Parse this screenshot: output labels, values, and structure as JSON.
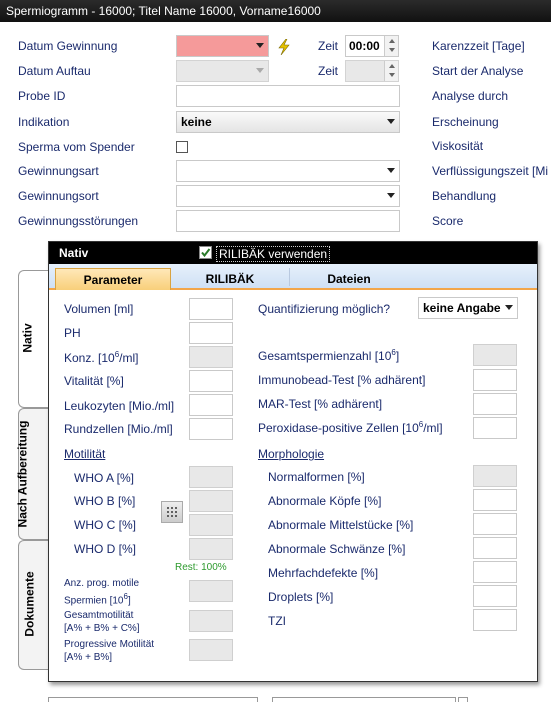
{
  "window": {
    "title": "Spermiogramm - 16000; Titel Name 16000, Vorname16000"
  },
  "form": {
    "datum_gewinnung": "Datum Gewinnung",
    "datum_auftau": "Datum Auftau",
    "probe_id": "Probe ID",
    "indikation": "Indikation",
    "indikation_value": "keine",
    "sperma_vom_spender": "Sperma vom Spender",
    "gewinnungsart": "Gewinnungsart",
    "gewinnungsort": "Gewinnungsort",
    "gewinnungsstoerungen": "Gewinnungsstörungen",
    "zeit1": "Zeit",
    "zeit1_value": "00:00",
    "zeit2": "Zeit"
  },
  "right_labels": {
    "karenzzeit": "Karenzzeit [Tage]",
    "start_analyse": "Start der Analyse",
    "analyse_durch": "Analyse durch",
    "erscheinung": "Erscheinung",
    "viskositaet": "Viskosität",
    "verfluessigungszeit": "Verflüssigungszeit [Mi",
    "behandlung": "Behandlung",
    "score": "Score"
  },
  "side_tabs": {
    "nativ": "Nativ",
    "nach_aufbereitung": "Nach Aufbereitung",
    "dokumente": "Dokumente"
  },
  "panel": {
    "header": "Nativ",
    "rilibak_checkbox": "RILIBÄK verwenden",
    "tabs": [
      "Parameter",
      "RILIBÄK",
      "Dateien"
    ],
    "volumen": "Volumen [ml]",
    "ph": "PH",
    "konz_a": "Konz. [10",
    "konz_sup": "6",
    "konz_b": "/ml]",
    "vitalitaet": "Vitalität [%]",
    "leukozyten": "Leukozyten [Mio./ml]",
    "rundzellen": "Rundzellen [Mio./ml]",
    "motilitaet": "Motilität",
    "who_a": "WHO A [%]",
    "who_b": "WHO B [%]",
    "who_c": "WHO C [%]",
    "who_d": "WHO D [%]",
    "rest": "Rest: 100%",
    "anz_prog_1": "Anz. prog. motile",
    "anz_prog_2a": "Spermien [10",
    "anz_prog_sup": "6",
    "anz_prog_2b": "]",
    "gesamtmotilitaet_1": "Gesamtmotilität",
    "gesamtmotilitaet_2": "[A% + B% + C%]",
    "progressive_1": "Progressive Motilität",
    "progressive_2": "[A% + B%]",
    "quantifizierung": "Quantifizierung möglich?",
    "quantifizierung_value": "keine Angabe",
    "gesamtspermienzahl_a": "Gesamtspermienzahl [10",
    "gesamtspermienzahl_sup": "6",
    "gesamtspermienzahl_b": "]",
    "immunobead": "Immunobead-Test [% adhärent]",
    "mar_test": "MAR-Test [% adhärent]",
    "peroxidase_a": "Peroxidase-positive Zellen [10",
    "peroxidase_sup": "6",
    "peroxidase_b": "/ml]",
    "morphologie": "Morphologie",
    "normalformen": "Normalformen [%]",
    "abnormale_koepfe": "Abnormale Köpfe [%]",
    "abnormale_mittelstuecke": "Abnormale Mittelstücke [%]",
    "abnormale_schwaenze": "Abnormale Schwänze [%]",
    "mehrfachdefekte": "Mehrfachdefekte [%]",
    "droplets": "Droplets [%]",
    "tzi": "TZI"
  },
  "colors": {
    "required_field": "#f59a9a",
    "tab_active": "#f8cf7a",
    "label": "#1a2a6c",
    "rest_text": "#2d9a2d"
  },
  "icons": {
    "bolt": "lightning-icon",
    "calculator": "calculator-icon"
  }
}
